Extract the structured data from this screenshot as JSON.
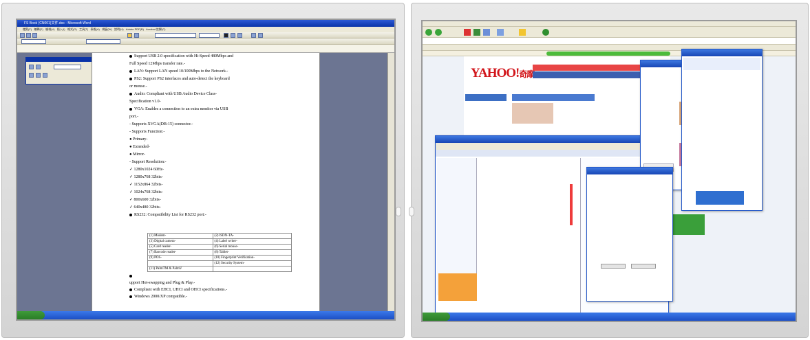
{
  "left_screen": {
    "word_title": "FS Book (CN001)文件.doc - Microsoft Word",
    "menu": [
      "檔案(F)",
      "編輯(E)",
      "檢視(V)",
      "插入(I)",
      "格式(O)",
      "工具(T)",
      "表格(A)",
      "視窗(W)",
      "說明(H)",
      "Adobe PDF(B)",
      "Acrobat 註解(C)"
    ],
    "lines": [
      {
        "bullet": true,
        "text": "Support USB 2.0 specification with Hi-Speed 480Mbps and"
      },
      {
        "bullet": false,
        "text": "Full Speed 12Mbps transfer rate.-"
      },
      {
        "bullet": true,
        "text": "LAN:    Support LAN speed 10/100Mbps to the Network.-"
      },
      {
        "bullet": true,
        "text": "PS2:    Support PS2 interfaces and auto-detect the keyboard"
      },
      {
        "bullet": false,
        "text": "or mouse.-"
      },
      {
        "bullet": true,
        "text": "Audio:   Compliant with USB Audio Device Class-"
      },
      {
        "bullet": false,
        "text": "                    Specification v1.0-"
      },
      {
        "bullet": true,
        "text": "VGA:   Enables a connection to an extra monitor via USB"
      },
      {
        "bullet": false,
        "text": "           port.-"
      },
      {
        "bullet": false,
        "text": "       -     Supports XVGA(DB-15) connector.-"
      },
      {
        "bullet": false,
        "text": "       -     Supports Function:-"
      },
      {
        "bullet": false,
        "text": "                  ●  Primary-"
      },
      {
        "bullet": false,
        "text": "                  ●  Extended-"
      },
      {
        "bullet": false,
        "text": "                  ●  Mirror-"
      },
      {
        "bullet": false,
        "text": "       -     Support Resolution:-"
      },
      {
        "bullet": false,
        "text": "              ✓  1280x1024     60Hz-"
      },
      {
        "bullet": false,
        "text": "              ✓  1280x768      32bits-"
      },
      {
        "bullet": false,
        "text": "              ✓  1152x864      32bits-"
      },
      {
        "bullet": false,
        "text": "              ✓  1024x768      32bits-"
      },
      {
        "bullet": false,
        "text": "              ✓  800x600       32bits-"
      },
      {
        "bullet": false,
        "text": "              ✓  640x480       32bits-"
      },
      {
        "bullet": true,
        "text": "RS232:    Compatibility List for RS232 port:-"
      }
    ],
    "rs232_table": [
      [
        "(1) Modem-",
        "(2) ISDN-TA-"
      ],
      [
        "(3) Digital camera-",
        "(4) Label writer-"
      ],
      [
        "(5) Card reader-",
        "(6) Serial mouse-"
      ],
      [
        "(7) Barcode reader-",
        "(8) Tablet-"
      ],
      [
        "(9) POS-",
        "(10) Fingerprint Verification-"
      ],
      [
        "",
        "(12) Security System-"
      ],
      [
        "(11) PalmTM & PalmV",
        ""
      ]
    ],
    "after_lines": [
      {
        "bullet": true,
        "text": ""
      },
      {
        "bullet": false,
        "text": "upport Hot-swapping and Plug & Play.-"
      },
      {
        "bullet": true,
        "text": "Compliant with EHCI, UHCI and OHCI specifications.-"
      },
      {
        "bullet": true,
        "text": "Windows 2000/XP compatible.-"
      }
    ]
  },
  "right_screen": {
    "yahoo_logo": "YAHOO!",
    "yahoo_sub": "奇摩",
    "colors": {
      "xp_blue": "#2458c8",
      "yahoo_red": "#d2161b",
      "taskbar": "#3b78e8"
    }
  }
}
